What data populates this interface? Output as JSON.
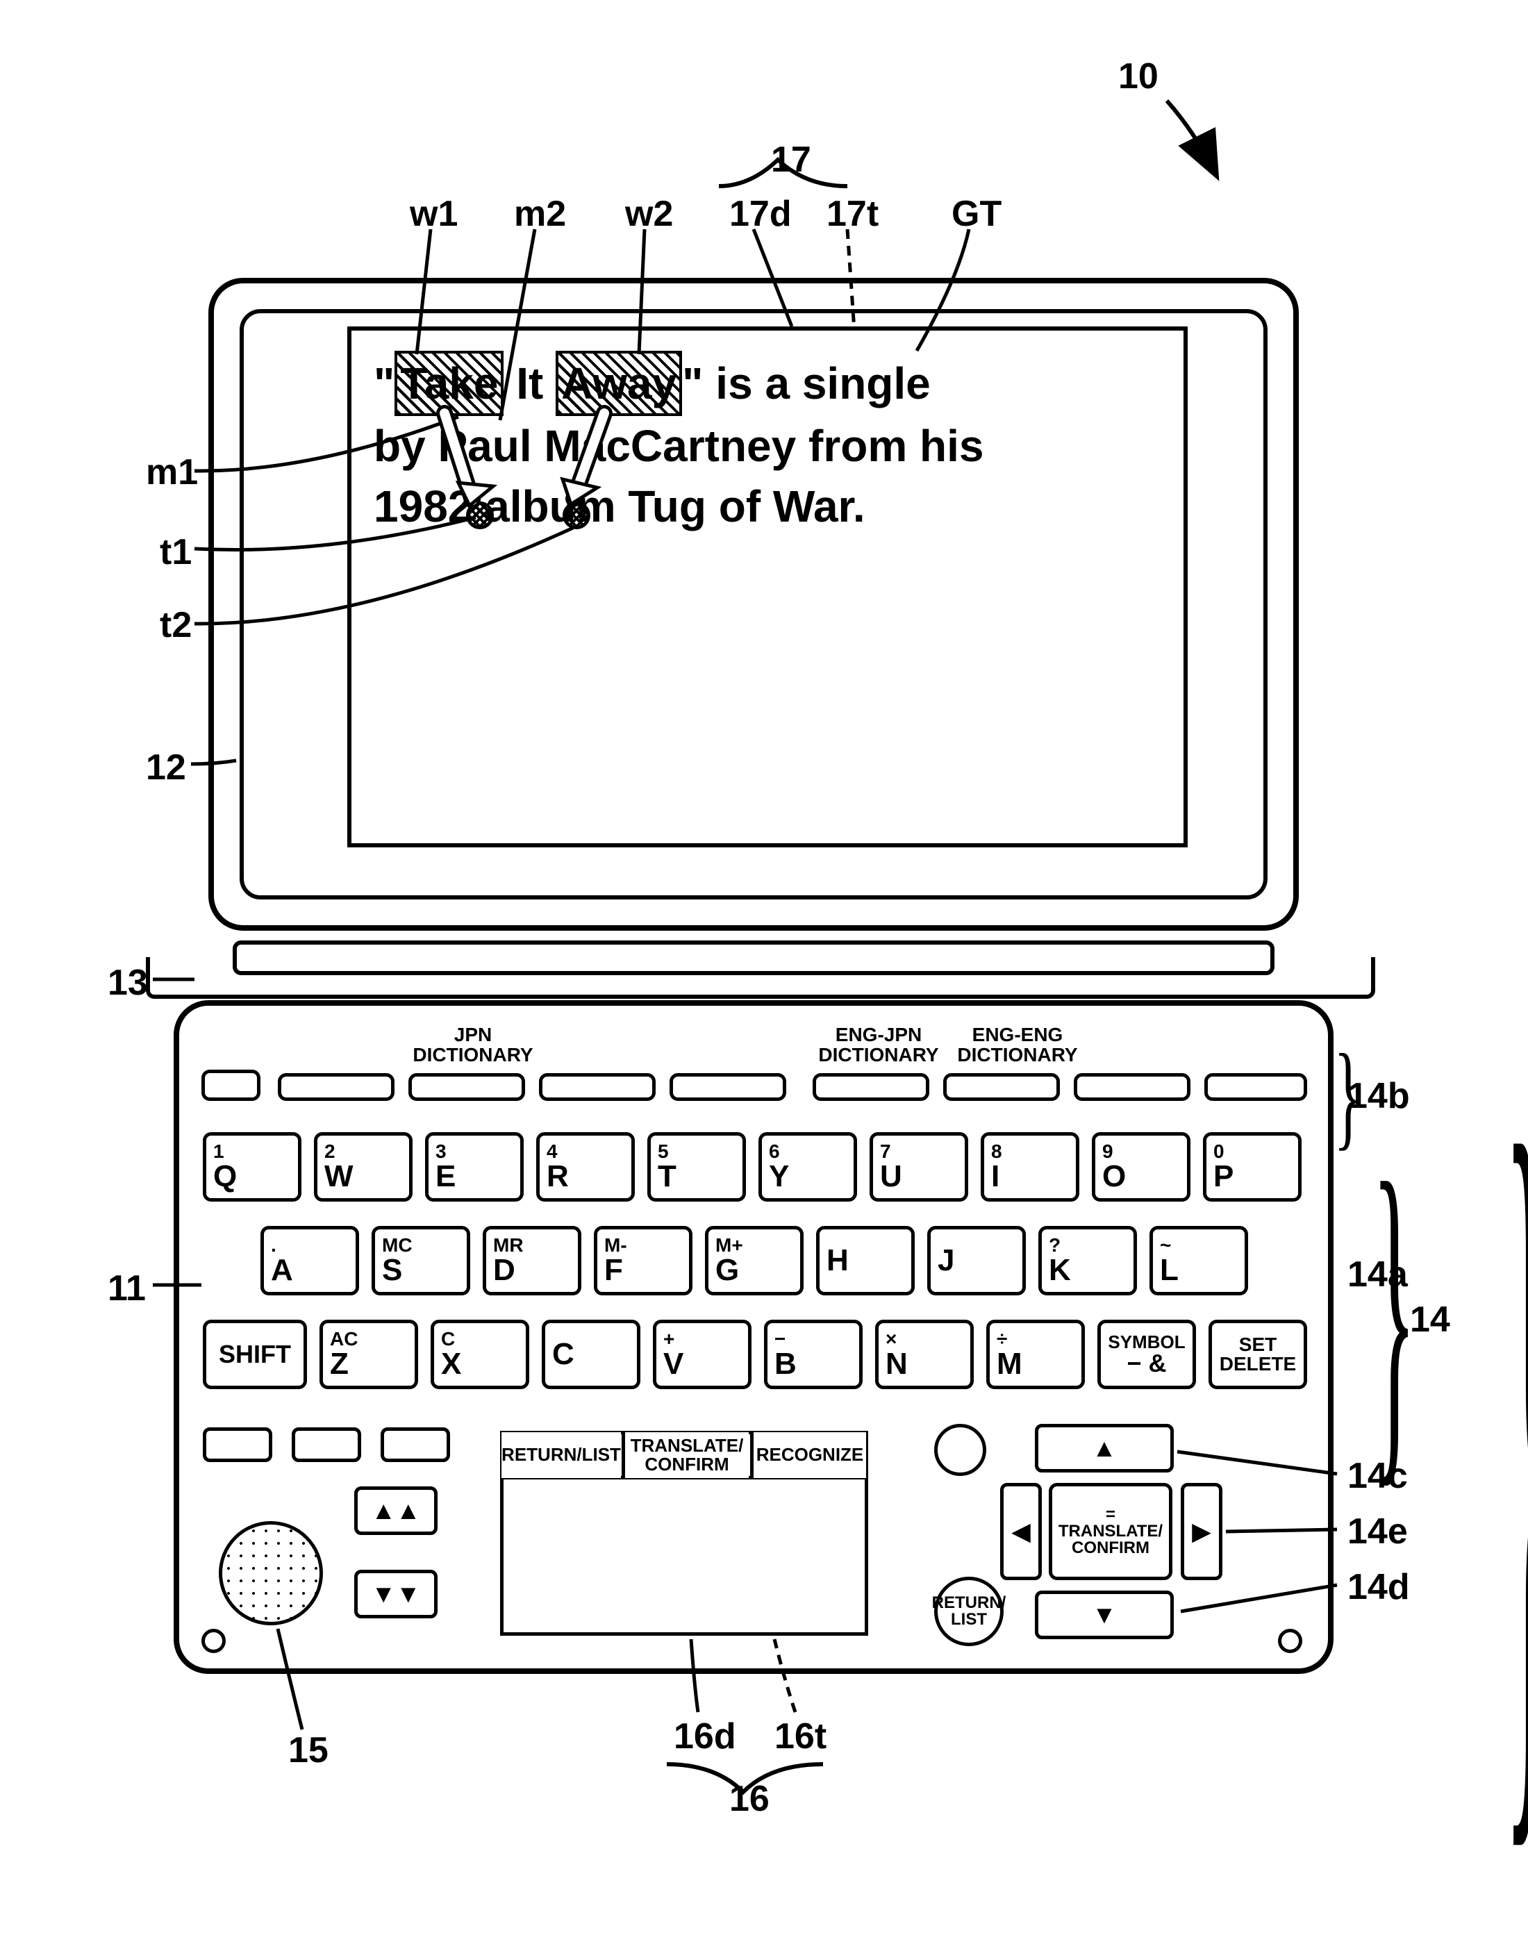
{
  "refs": {
    "r10": "10",
    "r17": "17",
    "r17d": "17d",
    "r17t": "17t",
    "rGT": "GT",
    "rw1": "w1",
    "rw2": "w2",
    "rm1": "m1",
    "rm2": "m2",
    "rt1": "t1",
    "rt2": "t2",
    "r12": "12",
    "r13": "13",
    "r11": "11",
    "r14": "14",
    "r14a": "14a",
    "r14b": "14b",
    "r14c": "14c",
    "r14d": "14d",
    "r14e": "14e",
    "r15": "15",
    "r16": "16",
    "r16d": "16d",
    "r16t": "16t"
  },
  "display": {
    "line1_pre": "\"",
    "w1": "Take",
    "mid": " It ",
    "w2": "Away",
    "line1_post": "\" is a single",
    "line2": "by Paul MacCartney from his",
    "line3": "1982 album Tug of War."
  },
  "funcLabels": {
    "jpn": "JPN\nDICTIONARY",
    "engjpn": "ENG-JPN\nDICTIONARY",
    "engeng": "ENG-ENG\nDICTIONARY"
  },
  "rows": {
    "r1": [
      {
        "sup": "1",
        "main": "Q"
      },
      {
        "sup": "2",
        "main": "W"
      },
      {
        "sup": "3",
        "main": "E"
      },
      {
        "sup": "4",
        "main": "R"
      },
      {
        "sup": "5",
        "main": "T"
      },
      {
        "sup": "6",
        "main": "Y"
      },
      {
        "sup": "7",
        "main": "U"
      },
      {
        "sup": "8",
        "main": "I"
      },
      {
        "sup": "9",
        "main": "O"
      },
      {
        "sup": "0",
        "main": "P"
      }
    ],
    "r2": [
      {
        "sup": ".",
        "main": "A"
      },
      {
        "sup": "MC",
        "main": "S"
      },
      {
        "sup": "MR",
        "main": "D"
      },
      {
        "sup": "M-",
        "main": "F"
      },
      {
        "sup": "M+",
        "main": "G"
      },
      {
        "sup": "",
        "main": "H"
      },
      {
        "sup": "",
        "main": "J"
      },
      {
        "sup": "?",
        "main": "K"
      },
      {
        "sup": "~",
        "main": "L"
      }
    ],
    "r3_shift": "SHIFT",
    "r3": [
      {
        "sup": "AC",
        "main": "Z"
      },
      {
        "sup": "C",
        "main": "X"
      },
      {
        "sup": "",
        "main": "C"
      },
      {
        "sup": "+",
        "main": "V"
      },
      {
        "sup": "−",
        "main": "B"
      },
      {
        "sup": "×",
        "main": "N"
      },
      {
        "sup": "÷",
        "main": "M"
      }
    ],
    "r3_sym": {
      "sup": "SYMBOL",
      "main": "− &"
    },
    "r3_set": {
      "sup": "SET",
      "main": "DELETE"
    }
  },
  "subpanel": {
    "returnlist": "RETURN/LIST",
    "translate": "TRANSLATE/\nCONFIRM",
    "recognize": "RECOGNIZE"
  },
  "dpad": {
    "center": "=\nTRANSLATE/\nCONFIRM",
    "returnlist": "RETURN/\nLIST"
  }
}
